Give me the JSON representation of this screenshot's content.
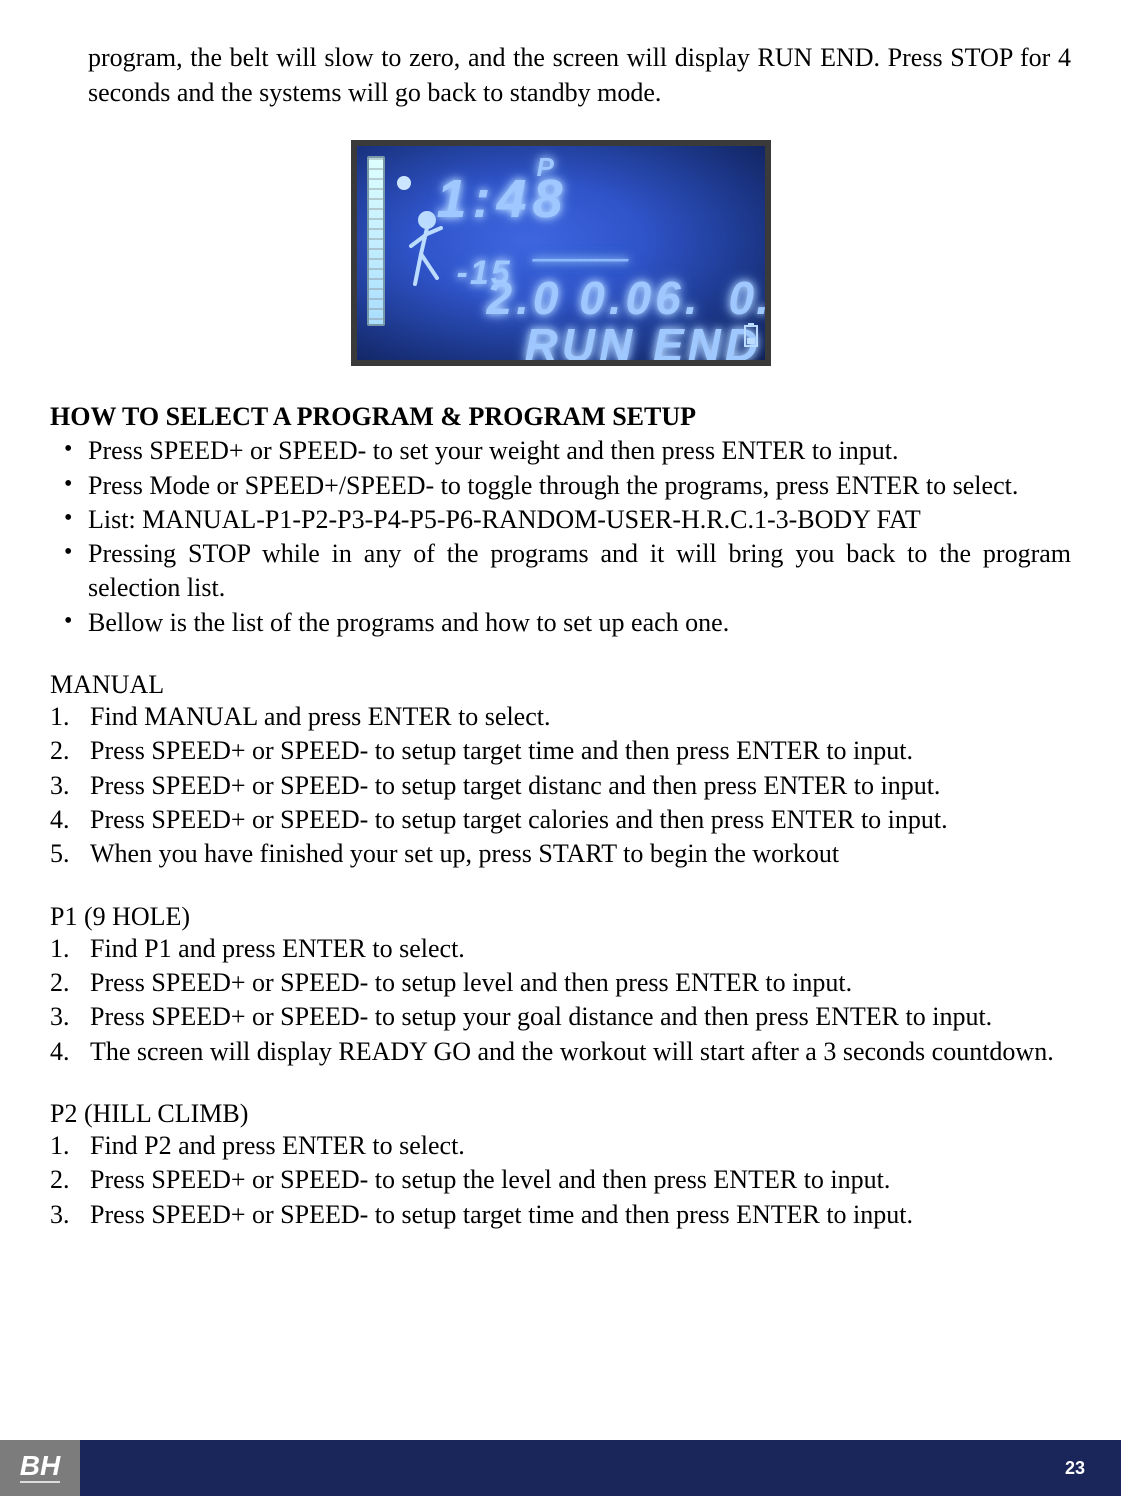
{
  "intro": "program, the belt will slow to zero, and the screen will display RUN END. Press STOP for 4 seconds and the systems will go back to standby mode.",
  "display": {
    "p_label": "P",
    "time": "1:48",
    "sub": "-15",
    "dashes": "------------------",
    "row_left": "2.0   0.06.",
    "row_right": "0.",
    "run_end": "RUN  END",
    "batt_icon_name": "battery-icon"
  },
  "heading": "HOW TO SELECT A PROGRAM & PROGRAM SETUP",
  "bullets": [
    "Press SPEED+ or SPEED- to set your weight and then press ENTER to input.",
    "Press Mode or SPEED+/SPEED- to toggle through the programs, press ENTER to select.",
    "List: MANUAL-P1-P2-P3-P4-P5-P6-RANDOM-USER-H.R.C.1-3-BODY FAT",
    "Pressing STOP while in any of the programs and it will bring you back to the program selection list.",
    "Bellow is the list of the programs and how to set up each one."
  ],
  "sections": [
    {
      "title": "MANUAL",
      "steps": [
        "Find MANUAL and press ENTER to select.",
        "Press SPEED+ or SPEED- to setup target time and then press ENTER to input.",
        "Press SPEED+ or SPEED- to setup target distanc and then press ENTER to input.",
        "Press SPEED+ or SPEED- to setup target calories and then press ENTER to input.",
        "When you have finished your set up, press START to begin the workout"
      ]
    },
    {
      "title": "P1 (9 HOLE)",
      "steps": [
        "Find P1 and press ENTER to select.",
        "Press SPEED+ or SPEED- to setup level and then press ENTER to input.",
        "Press SPEED+ or SPEED- to setup your goal distance and then press ENTER to input.",
        "The screen will display READY GO and the workout will start after a 3 seconds countdown."
      ]
    },
    {
      "title": "P2 (HILL CLIMB)",
      "steps": [
        "Find P2 and press ENTER to select.",
        "Press SPEED+ or SPEED- to setup the level and then press ENTER to input.",
        "Press SPEED+ or SPEED- to setup target time and then press ENTER to input."
      ]
    }
  ],
  "footer": {
    "logo": "BH",
    "page": "23"
  }
}
